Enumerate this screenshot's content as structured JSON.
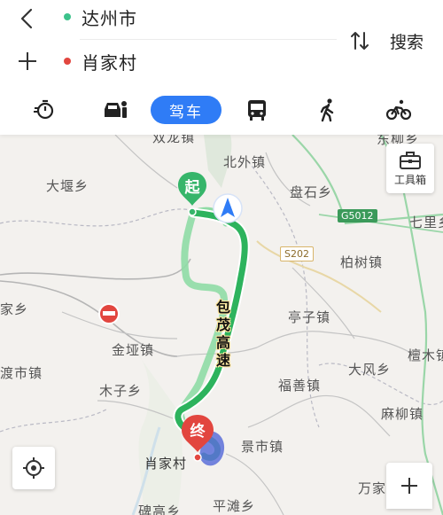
{
  "route": {
    "origin": "达州市",
    "destination": "肖家村",
    "origin_color": "#3cc28b",
    "destination_color": "#e2463f"
  },
  "header": {
    "search_label": "搜索"
  },
  "modes": {
    "active": "驾车",
    "icons": [
      "taxi-icon",
      "ride-hailing-icon",
      "car",
      "bus-icon",
      "walk-icon",
      "bike-icon"
    ]
  },
  "map": {
    "toolbox_label": "工具箱",
    "route_highway_name": "包茂高速",
    "start_marker_label": "起",
    "end_marker_label": "终",
    "places": {
      "shuanglong": "双龙镇",
      "beiwai": "北外镇",
      "dongliu": "东柳乡",
      "dayan": "大堰乡",
      "panshi": "盘石乡",
      "qili": "七里乡",
      "baishu": "柏树镇",
      "jiaxiang": "家乡",
      "tingzi": "亭子镇",
      "jinya": "金垭镇",
      "dushi": "渡市镇",
      "dafeng": "大风乡",
      "tanmu": "檀木镇",
      "muzi": "木子乡",
      "fushan": "福善镇",
      "maliu": "麻柳镇",
      "jingshi": "景市镇",
      "xiaojiacun": "肖家村",
      "wanjia": "万家",
      "pingtan": "平滩乡",
      "beigao": "碑高乡"
    },
    "road_badges": {
      "g5012": "G5012",
      "s202": "S202"
    },
    "route_color": "#2db35d",
    "alt_route_color": "#8fdba5"
  }
}
